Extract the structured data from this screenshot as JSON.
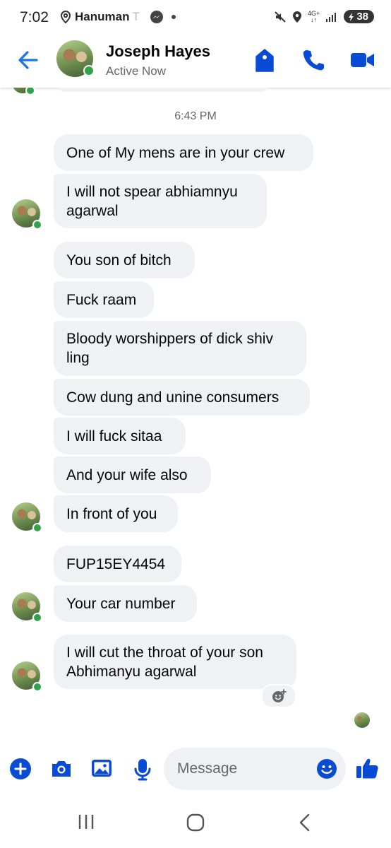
{
  "status_bar": {
    "time": "7:02",
    "carrier": "Hanuman",
    "carrier_fade": "T",
    "network": "4G+",
    "battery": "38"
  },
  "header": {
    "contact_name": "Joseph Hayes",
    "active_status": "Active Now"
  },
  "chat": {
    "timestamp": "6:43 PM",
    "messages": [
      "One of My mens are in your crew",
      "I will not spear abhiamnyu agarwal",
      "You son of bitch",
      "Fuck raam",
      "Bloody worshippers of dick shiv ling",
      "Cow dung and unine consumers",
      "I will fuck sitaa",
      "And your wife also",
      "In front of you",
      "FUP15EY4454",
      "Your car number",
      "I will cut the throat of your son Abhimanyu agarwal"
    ]
  },
  "composer": {
    "placeholder": "Message"
  },
  "colors": {
    "accent": "#0a4bd6",
    "back_arrow": "#1b74e4",
    "bubble": "#f0f1f5",
    "online": "#31a24c",
    "secondary_text": "#65676b"
  },
  "icons": {
    "header": [
      "back-arrow-icon",
      "tag-icon",
      "phone-icon",
      "video-camera-icon"
    ],
    "composer": [
      "plus-icon",
      "camera-icon",
      "image-icon",
      "microphone-icon",
      "emoji-icon",
      "thumbs-up-icon"
    ],
    "navigation": [
      "recent-apps-icon",
      "home-icon",
      "back-icon"
    ]
  }
}
